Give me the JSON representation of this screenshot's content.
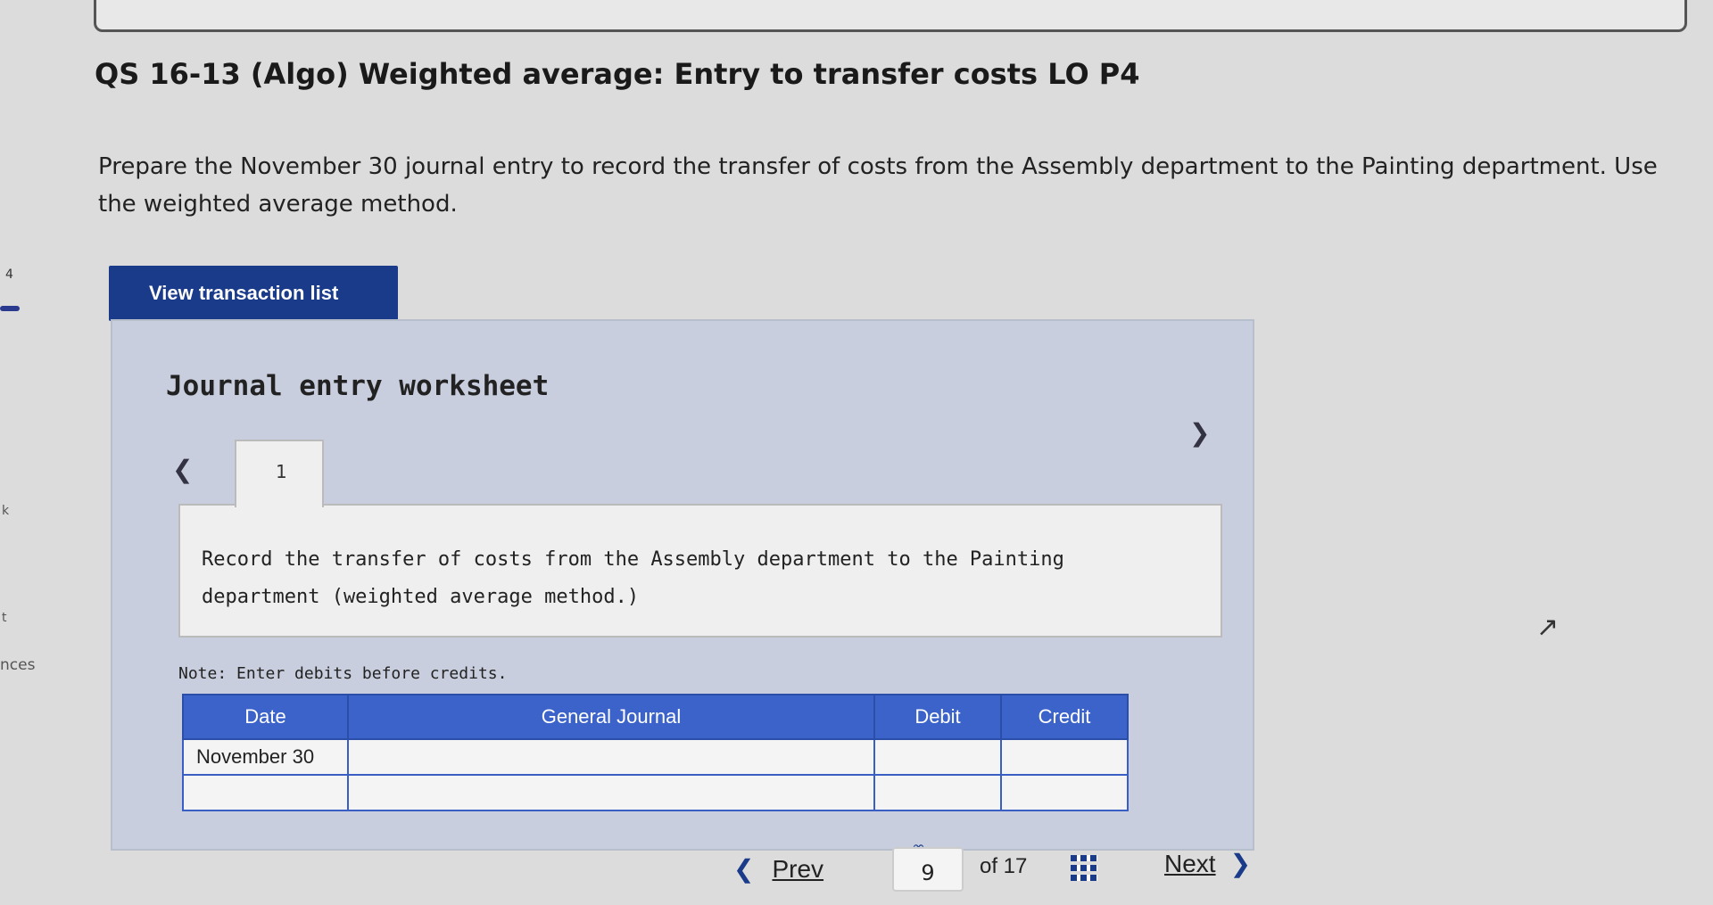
{
  "header": {
    "title": "QS 16-13 (Algo) Weighted average: Entry to transfer costs LO P4"
  },
  "left_rail": {
    "number": "4",
    "letter_k": "k",
    "letter_t": "t",
    "partial_label": "nces"
  },
  "instructions": "Prepare the November 30 journal entry to record the transfer of costs from the Assembly department to the Painting department. Use the weighted average method.",
  "view_transaction_button": "View transaction list",
  "worksheet": {
    "title": "Journal entry worksheet",
    "tab_label": "1",
    "record_text": "Record the transfer of costs from the Assembly department to the Painting department (weighted average method.)",
    "note": "Note: Enter debits before credits.",
    "table": {
      "headers": [
        "Date",
        "General Journal",
        "Debit",
        "Credit"
      ],
      "rows": [
        {
          "date": "November 30",
          "account": "",
          "debit": "",
          "credit": ""
        },
        {
          "date": "",
          "account": "",
          "debit": "",
          "credit": ""
        }
      ]
    }
  },
  "pagination": {
    "prev_label": "Prev",
    "current_page": "9",
    "of_total": "of 17",
    "next_label": "Next"
  },
  "colors": {
    "button_blue": "#1a3a8a",
    "table_header_blue": "#3b63c9",
    "worksheet_bg": "#c8cedd"
  }
}
